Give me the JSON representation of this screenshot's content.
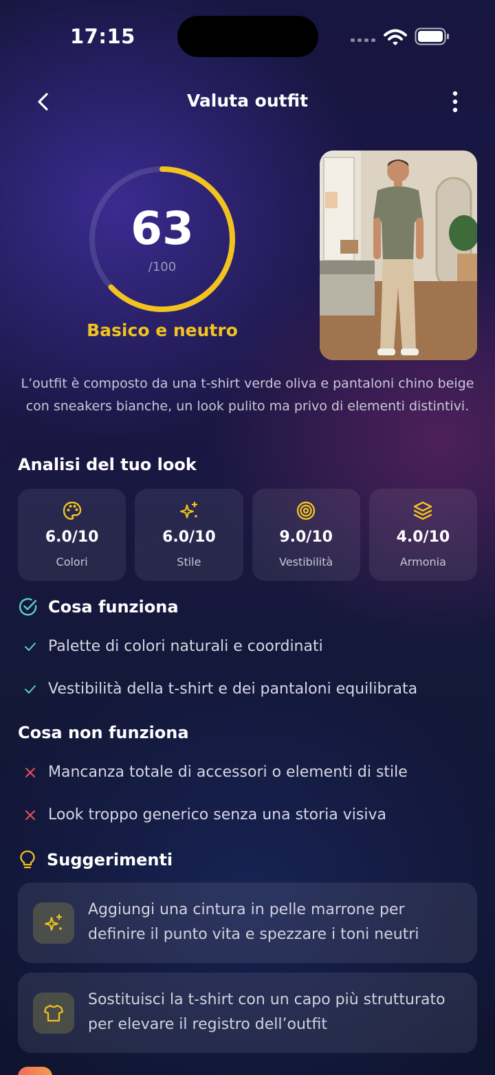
{
  "status_bar": {
    "time": "17:15"
  },
  "header": {
    "title": "Valuta outfit",
    "back_icon": "chevron-left-icon",
    "menu_icon": "more-vertical-icon"
  },
  "score": {
    "value": "63",
    "max": "/100",
    "fraction": 0.63,
    "label": "Basico e neutro",
    "accent": "#f2c31f"
  },
  "description": "L’outfit è composto da una t-shirt verde oliva e pantaloni chino beige con sneakers bianche, un look pulito ma privo di elementi distintivi.",
  "analysis": {
    "title": "Analisi del tuo look",
    "cards": [
      {
        "icon": "palette-icon",
        "value": "6.0/10",
        "label": "Colori"
      },
      {
        "icon": "sparkles-icon",
        "value": "6.0/10",
        "label": "Stile"
      },
      {
        "icon": "target-icon",
        "value": "9.0/10",
        "label": "Vestibilità"
      },
      {
        "icon": "layers-icon",
        "value": "4.0/10",
        "label": "Armonia"
      }
    ]
  },
  "works": {
    "title": "Cosa funziona",
    "color": "#5ed1c2",
    "items": [
      "Palette di colori naturali e coordinati",
      "Vestibilità della t-shirt e dei pantaloni equilibrata"
    ]
  },
  "not_works": {
    "title": "Cosa non funziona",
    "color": "#e8525a",
    "items": [
      "Mancanza totale di accessori o elementi di stile",
      "Look troppo generico senza una storia visiva"
    ]
  },
  "suggestions": {
    "title": "Suggerimenti",
    "items": [
      {
        "icon": "sparkles-icon",
        "text": "Aggiungi una cintura in pelle marrone per definire il punto vita e spezzare i toni neutri"
      },
      {
        "icon": "shirt-icon",
        "text": "Sostituisci la t-shirt con un capo più strutturato per elevare il registro dell’outfit"
      }
    ]
  }
}
